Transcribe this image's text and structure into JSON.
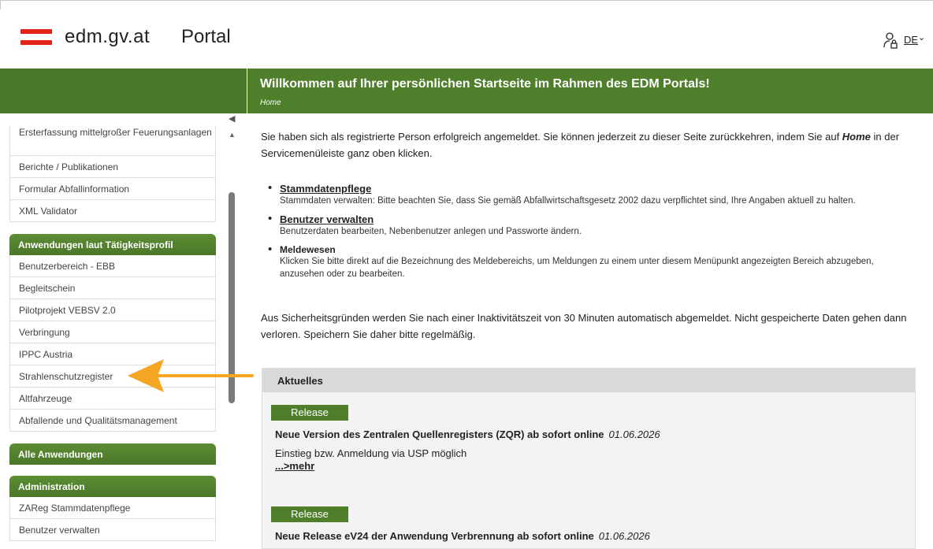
{
  "header": {
    "brand": "edm.gv.at",
    "portal": "Portal",
    "language": "DE",
    "language_chevron": "⌄",
    "user_icon": "user-lock-icon"
  },
  "banner": {
    "title": "Willkommen auf Ihrer persönlichen Startseite im Rahmen des EDM Portals!",
    "breadcrumb": "Home"
  },
  "sidebar": {
    "group1": [
      "Ersterfassung mittelgroßer Feuerungsanlagen",
      "Berichte / Publikationen",
      "Formular Abfallinformation",
      "XML Validator"
    ],
    "group2_title": "Anwendungen laut Tätigkeitsprofil",
    "group2": [
      "Benutzerbereich - EBB",
      "Begleitschein",
      "Pilotprojekt VEBSV 2.0",
      "Verbringung",
      "IPPC Austria",
      "Strahlenschutzregister",
      "Altfahrzeuge",
      "Abfallende und Qualitätsmanagement"
    ],
    "group3_title": "Alle Anwendungen",
    "group4_title": "Administration",
    "group4": [
      "ZAReg Stammdatenpflege",
      "Benutzer verwalten"
    ]
  },
  "main": {
    "intro_part1": "Sie haben sich als registrierte Person erfolgreich angemeldet. Sie können jederzeit zu dieser Seite zurückkehren, indem Sie auf ",
    "intro_home": "Home",
    "intro_part2": " in der Servicemenüleiste ganz oben klicken.",
    "bullets": [
      {
        "title": "Stammdatenpflege",
        "desc": "Stammdaten verwalten: Bitte beachten Sie, dass Sie gemäß Abfallwirtschaftsgesetz 2002 dazu verpflichtet sind, Ihre Angaben aktuell zu halten."
      },
      {
        "title": "Benutzer verwalten",
        "desc": "Benutzerdaten bearbeiten, Nebenbenutzer anlegen und Passworte ändern."
      },
      {
        "title": "Meldewesen",
        "desc": "Klicken Sie bitte direkt auf die Bezeichnung des Meldebereichs, um Meldungen zu einem unter diesem Menüpunkt angezeigten Bereich abzugeben, anzusehen oder zu bearbeiten."
      }
    ],
    "security": "Aus Sicherheitsgründen werden Sie nach einer Inaktivitätszeit von 30 Minuten automatisch abgemeldet. Nicht gespeicherte Daten gehen dann verloren. Speichern Sie daher bitte regelmäßig."
  },
  "news": {
    "heading": "Aktuelles",
    "items": [
      {
        "tag": "Release",
        "title": "Neue Version des Zentralen Quellenregisters (ZQR) ab sofort online",
        "date": "01.06.2026",
        "text": "Einstieg bzw. Anmeldung via USP möglich",
        "more": "...>mehr"
      },
      {
        "tag": "Release",
        "title": "Neue Release eV24 der Anwendung Verbrennung ab sofort online",
        "date": "01.06.2026"
      }
    ]
  },
  "colors": {
    "green": "#4f7f2b",
    "arrow": "#f5a623",
    "flag_red": "#e2231a"
  }
}
